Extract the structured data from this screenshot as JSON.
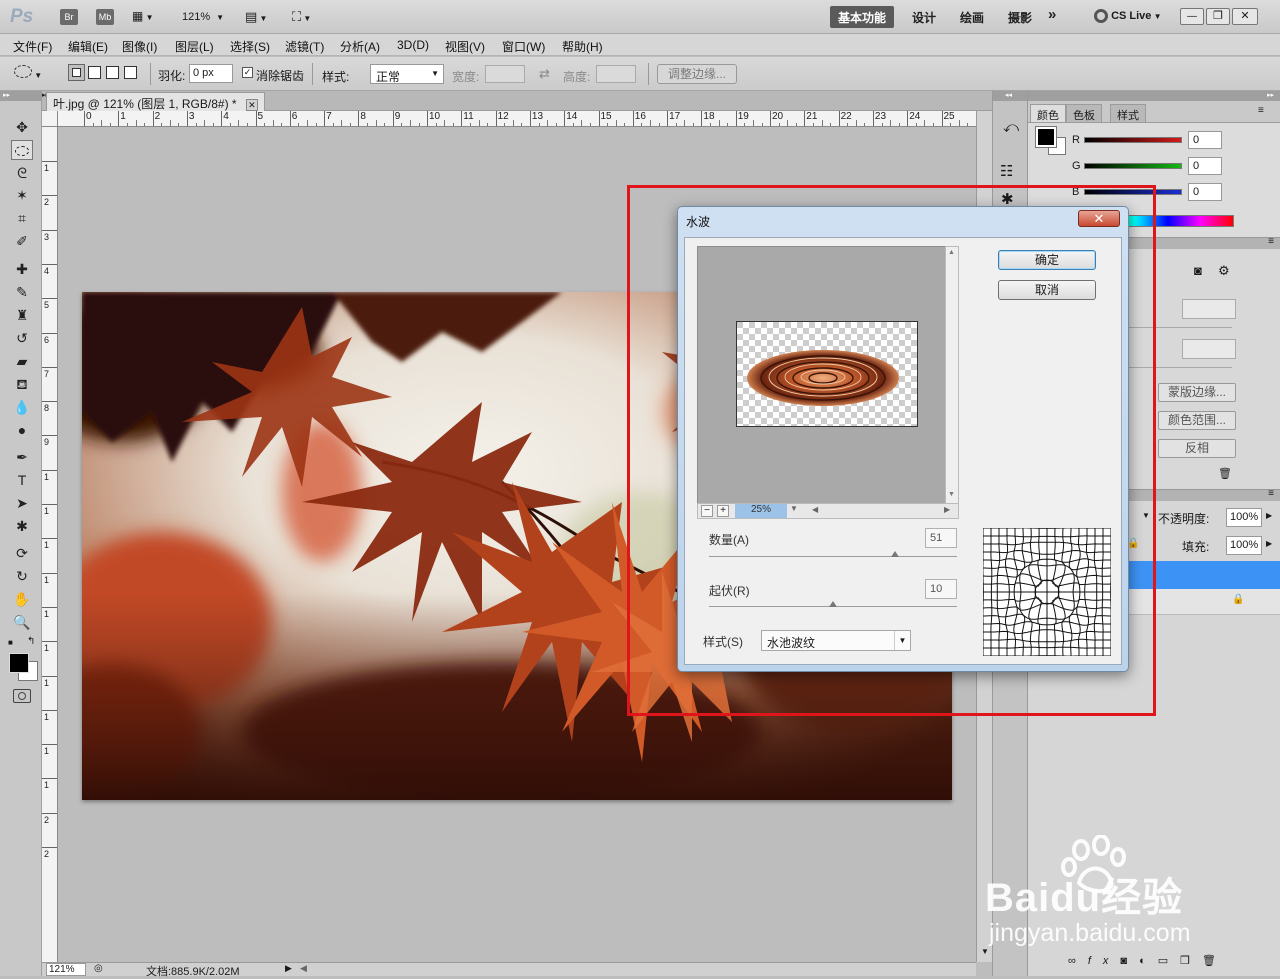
{
  "appbar": {
    "logo": "Ps",
    "bridge": "Br",
    "minibridge": "Mb",
    "zoom": "121%",
    "workspaces": [
      "基本功能",
      "设计",
      "绘画",
      "摄影"
    ],
    "more": "»",
    "cslive": "CS Live",
    "window_minimize": "—",
    "window_restore": "❐",
    "window_close": "✕"
  },
  "menu": [
    "文件(F)",
    "编辑(E)",
    "图像(I)",
    "图层(L)",
    "选择(S)",
    "滤镜(T)",
    "分析(A)",
    "3D(D)",
    "视图(V)",
    "窗口(W)",
    "帮助(H)"
  ],
  "options": {
    "feather_label": "羽化:",
    "feather_value": "0 px",
    "antialias_label": "消除锯齿",
    "antialias_checked": true,
    "style_label": "样式:",
    "style_value": "正常",
    "width_label": "宽度:",
    "height_label": "高度:",
    "refine_edge": "调整边缘..."
  },
  "document": {
    "tab_title": "叶.jpg @ 121% (图层 1, RGB/8#) *",
    "tab_close": "✕",
    "ruler_h": [
      "0",
      "1",
      "2",
      "3",
      "4",
      "5",
      "6",
      "7",
      "8",
      "9",
      "10",
      "11",
      "12",
      "13",
      "14",
      "15",
      "16",
      "17",
      "18",
      "19",
      "20",
      "21",
      "22",
      "23",
      "24",
      "25"
    ],
    "ruler_v": [
      "1",
      "2",
      "3",
      "4",
      "5",
      "6",
      "7",
      "8",
      "9",
      "1",
      "1",
      "1",
      "1",
      "1",
      "1",
      "1",
      "1",
      "1",
      "1",
      "2",
      "2"
    ],
    "status_zoom": "121%",
    "status_doc": "文档:885.9K/2.02M"
  },
  "color_panel": {
    "tabs": [
      "颜色",
      "色板",
      "样式"
    ],
    "r_label": "R",
    "g_label": "G",
    "b_label": "B",
    "r": "0",
    "g": "0",
    "b": "0"
  },
  "masks_panel": {
    "mask_edge": "蒙版边缘...",
    "color_range": "颜色范围...",
    "invert": "反相"
  },
  "layers_panel": {
    "opacity_label": "不透明度:",
    "opacity": "100%",
    "fill_label": "填充:",
    "fill": "100%"
  },
  "dialog": {
    "title": "水波",
    "close": "✕",
    "ok": "确定",
    "cancel": "取消",
    "zoom": "25%",
    "minus": "−",
    "plus": "+",
    "amount_label": "数量(A)",
    "amount": "51",
    "amount_fraction": 0.75,
    "ridges_label": "起伏(R)",
    "ridges": "10",
    "ridges_fraction": 0.5,
    "style_label": "样式(S)",
    "style_value": "水池波纹"
  },
  "watermark": {
    "brand": "Baidu经验",
    "url": "jingyan.baidu.com"
  },
  "colors": {
    "highlight": "#e0141b",
    "layer_selected": "#3d93f5",
    "r_slider": "#d41a1a",
    "g_slider": "#14b814",
    "b_slider": "#1a2fd4"
  }
}
